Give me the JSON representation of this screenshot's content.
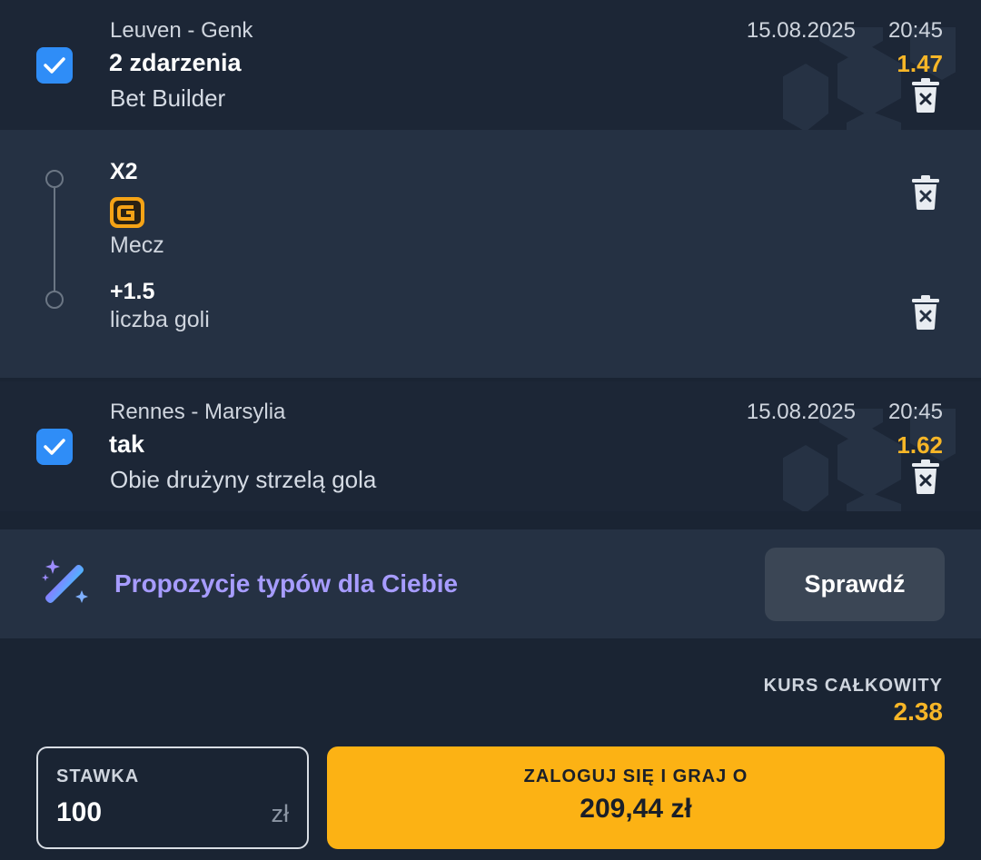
{
  "bets": [
    {
      "match": "Leuven - Genk",
      "date": "15.08.2025",
      "time": "20:45",
      "title": "2 zdarzenia",
      "subtitle": "Bet Builder",
      "odds": "1.47",
      "checked": true
    },
    {
      "match": "Rennes - Marsylia",
      "date": "15.08.2025",
      "time": "20:45",
      "title": "tak",
      "subtitle": "Obie drużyny strzelą gola",
      "odds": "1.62",
      "checked": true
    }
  ],
  "builder": {
    "selections": [
      {
        "title": "X2",
        "subtitle": "Mecz"
      },
      {
        "title": "+1.5",
        "subtitle": "liczba goli"
      }
    ]
  },
  "suggestion": {
    "text": "Propozycje typów dla Ciebie",
    "button_label": "Sprawdź"
  },
  "total": {
    "label": "KURS CAŁKOWITY",
    "value": "2.38"
  },
  "stake": {
    "label": "STAWKA",
    "value": "100",
    "currency": "zł"
  },
  "login_button": {
    "line1": "ZALOGUJ SIĘ I GRAJ O",
    "line2": "209,44 zł"
  },
  "colors": {
    "accent": "#fcb214",
    "odds": "#f7b627",
    "checkbox": "#2f8df7",
    "suggestion": "#a79cff"
  },
  "icons": [
    "checkbox-check-icon",
    "trash-icon",
    "g-badge-icon",
    "magic-wand-icon",
    "football-deco-icon"
  ]
}
